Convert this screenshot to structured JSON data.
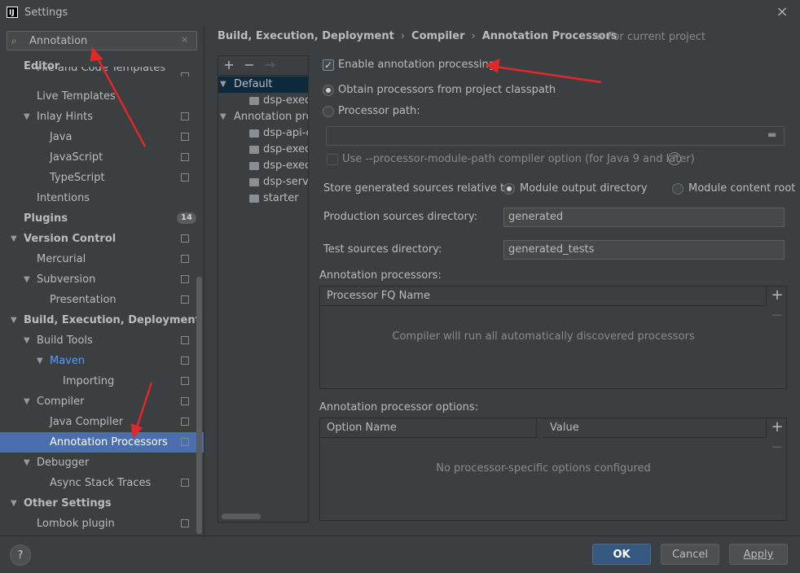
{
  "window": {
    "title": "Settings",
    "close_icon": "×",
    "app_icon_letter": "IJ"
  },
  "search": {
    "value": "Annotation",
    "clear_icon": "×",
    "search_icon": "⌕"
  },
  "sidebar": {
    "items": [
      {
        "label": "Editor",
        "level": 0,
        "bold": true,
        "chev": ""
      },
      {
        "label": "File and Code Templates",
        "level": 1,
        "chev": "",
        "proj": true
      },
      {
        "label": "Live Templates",
        "level": 1,
        "chev": ""
      },
      {
        "label": "Inlay Hints",
        "level": 1,
        "chev": "▼",
        "proj": true
      },
      {
        "label": "Java",
        "level": 2,
        "chev": "",
        "proj": true
      },
      {
        "label": "JavaScript",
        "level": 2,
        "chev": "",
        "proj": true
      },
      {
        "label": "TypeScript",
        "level": 2,
        "chev": "",
        "proj": true
      },
      {
        "label": "Intentions",
        "level": 1,
        "chev": ""
      },
      {
        "label": "Plugins",
        "level": 0,
        "bold": true,
        "chev": "",
        "badge": "14"
      },
      {
        "label": "Version Control",
        "level": 0,
        "bold": true,
        "chev": "▼",
        "proj": true
      },
      {
        "label": "Mercurial",
        "level": 1,
        "chev": "",
        "proj": true
      },
      {
        "label": "Subversion",
        "level": 1,
        "chev": "▼",
        "proj": true
      },
      {
        "label": "Presentation",
        "level": 2,
        "chev": "",
        "proj": true
      },
      {
        "label": "Build, Execution, Deployment",
        "level": 0,
        "bold": true,
        "chev": "▼"
      },
      {
        "label": "Build Tools",
        "level": 1,
        "chev": "▼",
        "proj": true
      },
      {
        "label": "Maven",
        "level": 2,
        "chev": "▼",
        "proj": true,
        "link": true
      },
      {
        "label": "Importing",
        "level": 3,
        "chev": "",
        "proj": true
      },
      {
        "label": "Compiler",
        "level": 1,
        "chev": "▼",
        "proj": true
      },
      {
        "label": "Java Compiler",
        "level": 2,
        "chev": "",
        "proj": true
      },
      {
        "label": "Annotation Processors",
        "level": 2,
        "chev": "",
        "proj": true,
        "selected": true
      },
      {
        "label": "Debugger",
        "level": 1,
        "chev": "▼"
      },
      {
        "label": "Async Stack Traces",
        "level": 2,
        "chev": "",
        "proj": true
      },
      {
        "label": "Other Settings",
        "level": 0,
        "bold": true,
        "chev": "▼"
      },
      {
        "label": "Lombok plugin",
        "level": 1,
        "chev": "",
        "proj": true
      }
    ]
  },
  "breadcrumb": {
    "items": [
      "Build, Execution, Deployment",
      "Compiler",
      "Annotation Processors"
    ],
    "separator": "›",
    "scope": "For current project",
    "scope_icon": "⧉"
  },
  "profiles": {
    "toolbar": {
      "add": "+",
      "remove": "−",
      "move": "→"
    },
    "rows": [
      {
        "label": "Default",
        "chev": "▼",
        "indent": 0,
        "selected": true,
        "folder": false
      },
      {
        "label": "dsp-execu",
        "chev": "",
        "indent": 2,
        "folder": true
      },
      {
        "label": "Annotation profi",
        "chev": "▼",
        "indent": 0,
        "folder": false
      },
      {
        "label": "dsp-api-c",
        "chev": "",
        "indent": 2,
        "folder": true
      },
      {
        "label": "dsp-execu",
        "chev": "",
        "indent": 2,
        "folder": true
      },
      {
        "label": "dsp-execu",
        "chev": "",
        "indent": 2,
        "folder": true
      },
      {
        "label": "dsp-servi",
        "chev": "",
        "indent": 2,
        "folder": true
      },
      {
        "label": "starter",
        "chev": "",
        "indent": 2,
        "folder": true
      }
    ]
  },
  "settings": {
    "enable_label": "Enable annotation processing",
    "enable_checked": true,
    "obtain_label": "Obtain processors from project classpath",
    "processor_path_label": "Processor path:",
    "processor_path_value": "",
    "folder_icon": "▬",
    "module_path_label": "Use --processor-module-path compiler option (for Java 9 and later)",
    "help_icon": "?",
    "store_label": "Store generated sources relative to:",
    "module_output_label": "Module output directory",
    "module_content_label": "Module content root",
    "production_label": "Production sources directory:",
    "production_value": "generated",
    "test_label": "Test sources directory:",
    "test_value": "generated_tests",
    "processors_label": "Annotation processors:",
    "processors_col": "Processor FQ Name",
    "processors_empty": "Compiler will run all automatically discovered processors",
    "options_label": "Annotation processor options:",
    "options_col1": "Option Name",
    "options_col2": "Value",
    "options_empty": "No processor-specific options configured",
    "add_icon": "+",
    "remove_icon": "−"
  },
  "buttons": {
    "help": "?",
    "ok": "OK",
    "cancel": "Cancel",
    "apply": "Apply"
  },
  "colors": {
    "selection": "#4b6eaf",
    "primary_button": "#365880",
    "arrow": "#e02828",
    "link": "#589df6"
  }
}
